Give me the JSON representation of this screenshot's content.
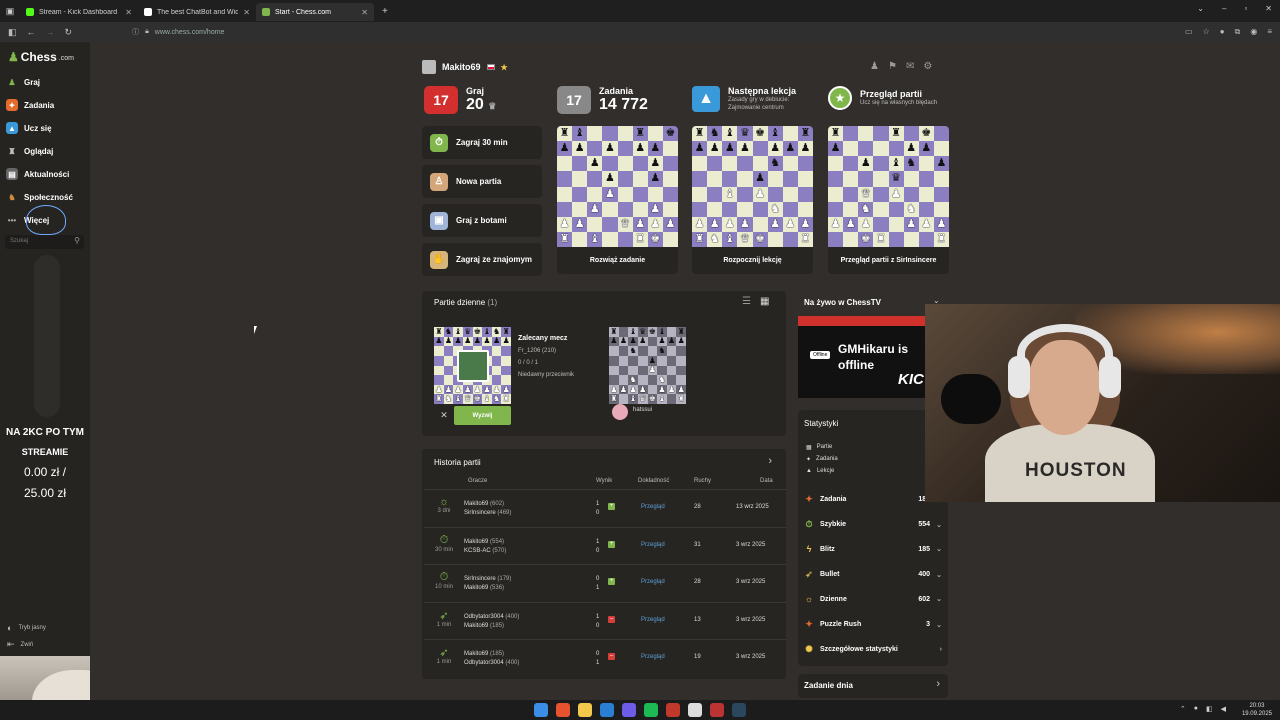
{
  "browser": {
    "tabs": [
      {
        "title": "Stream - Kick Dashboard",
        "active": false,
        "color": "#53fc18"
      },
      {
        "title": "The best ChatBot and Widg",
        "active": false,
        "color": "#ffffff"
      },
      {
        "title": "Start - Chess.com",
        "active": true,
        "color": "#81b64c"
      }
    ],
    "new_tab": "+",
    "url": "www.chess.com/home"
  },
  "sidebar": {
    "logo_main": "Chess",
    "logo_suffix": ".com",
    "items": [
      {
        "label": "Graj",
        "icon": "pawn-icon",
        "color": "#81b64c"
      },
      {
        "label": "Zadania",
        "icon": "puzzle-icon",
        "color": "#e46a2e"
      },
      {
        "label": "Ucz się",
        "icon": "learn-icon",
        "color": "#3a9ad9"
      },
      {
        "label": "Oglądaj",
        "icon": "watch-icon",
        "color": "#c0392b"
      },
      {
        "label": "Aktualności",
        "icon": "news-icon",
        "color": "#8a8a8a"
      },
      {
        "label": "Społeczność",
        "icon": "community-icon",
        "color": "#d18b3c"
      },
      {
        "label": "Więcej",
        "icon": "more-icon",
        "color": "#8a8a8a"
      }
    ],
    "search_placeholder": "Szukaj",
    "bottom": [
      {
        "label": "Tryb jasny"
      },
      {
        "label": "Zwiń"
      }
    ]
  },
  "stream_overlay": {
    "line1": "NA 2KC PO TYM",
    "line2": "STREAMIE",
    "line3": "0.00 zł /",
    "line4": "25.00 zł"
  },
  "user": {
    "name": "Makito69"
  },
  "play": {
    "label": "Graj",
    "rating": "20"
  },
  "puzzles": {
    "label": "Zadania",
    "rating": "14 772"
  },
  "lesson": {
    "label": "Następna lekcja",
    "sub": "Zasady gry w debiucie: Zajmowanie centrum"
  },
  "review": {
    "label": "Przegląd partii",
    "sub": "Ucz się na własnych błędach"
  },
  "badge_number": "17",
  "play_buttons": [
    {
      "label": "Zagraj 30 min",
      "icon": "stopwatch-icon",
      "color": "#81b64c"
    },
    {
      "label": "Nowa partia",
      "icon": "new-game-icon",
      "color": "#d2a679"
    },
    {
      "label": "Graj z botami",
      "icon": "bot-icon",
      "color": "#9fb4d6"
    },
    {
      "label": "Zagraj ze znajomym",
      "icon": "handshake-icon",
      "color": "#d7b47a"
    }
  ],
  "cards": [
    {
      "footer": "Rozwiąż zadanie"
    },
    {
      "footer": "Rozpocznij lekcję"
    },
    {
      "footer": "Przegląd partii z SirInsincere"
    }
  ],
  "daily": {
    "title": "Partie dzienne",
    "count": "(1)",
    "match_title": "Zalecany mecz",
    "match_player": "Fr_1206",
    "match_rating": "(210)",
    "match_record": "0 / 0 / 1",
    "match_note": "Niedawny przeciwnik",
    "challenge": "Wyzwij",
    "opponent": "hatssui"
  },
  "history": {
    "title": "Historia partii",
    "headers": {
      "players": "Gracze",
      "result": "Wynik",
      "accuracy": "Dokładność",
      "moves": "Ruchy",
      "date": "Data"
    },
    "rows": [
      {
        "time": "3 dni",
        "p1": "Makito69",
        "p1r": "(602)",
        "p2": "SirInsincere",
        "p2r": "(469)",
        "s1": "1",
        "s2": "0",
        "win": true,
        "acc": "Przegląd",
        "moves": "28",
        "date": "13 wrz 2025"
      },
      {
        "time": "30 min",
        "p1": "Makito69",
        "p1r": "(554)",
        "p2": "KCSB-AC",
        "p2r": "(570)",
        "s1": "1",
        "s2": "0",
        "win": true,
        "acc": "Przegląd",
        "moves": "31",
        "date": "3 wrz 2025"
      },
      {
        "time": "10 min",
        "p1": "SirInsincere",
        "p1r": "(179)",
        "p2": "Makito69",
        "p2r": "(536)",
        "s1": "0",
        "s2": "1",
        "win": true,
        "acc": "Przegląd",
        "moves": "28",
        "date": "3 wrz 2025"
      },
      {
        "time": "1 min",
        "p1": "Odbytator3004",
        "p1r": "(400)",
        "p2": "Makito69",
        "p2r": "(185)",
        "s1": "1",
        "s2": "0",
        "win": false,
        "acc": "Przegląd",
        "moves": "13",
        "date": "3 wrz 2025"
      },
      {
        "time": "1 min",
        "p1": "Makito69",
        "p1r": "(185)",
        "p2": "Odbytator3004",
        "p2r": "(400)",
        "s1": "0",
        "s2": "1",
        "win": false,
        "acc": "Przegląd",
        "moves": "19",
        "date": "3 wrz 2025"
      }
    ]
  },
  "right": {
    "tv_title": "Na żywo w ChessTV",
    "tv_offline_tag": "Offline",
    "tv_name": "GMHikaru is offline",
    "tv_brand": "KIC",
    "stats_title": "Statystyki",
    "stats_small": [
      "Partie",
      "Zadania",
      "Lekcje"
    ],
    "stats": [
      {
        "label": "Zadania",
        "value": "180",
        "icon": "puzzle-icon",
        "color": "#e46a2e"
      },
      {
        "label": "Szybkie",
        "value": "554",
        "icon": "stopwatch-icon",
        "color": "#81b64c"
      },
      {
        "label": "Blitz",
        "value": "185",
        "icon": "lightning-icon",
        "color": "#f2c94c"
      },
      {
        "label": "Bullet",
        "value": "400",
        "icon": "bullet-icon",
        "color": "#c8a84b"
      },
      {
        "label": "Dzienne",
        "value": "602",
        "icon": "sun-icon",
        "color": "#f2c94c"
      },
      {
        "label": "Puzzle Rush",
        "value": "3",
        "icon": "rush-icon",
        "color": "#e46a2e"
      }
    ],
    "detailed": "Szczegółowe statystyki",
    "daily_puzzle": "Zadanie dnia"
  },
  "webcam": {
    "hoodie_text": "HOUSTON"
  },
  "taskbar": {
    "time": "20:03",
    "date": "19.09.2025"
  }
}
